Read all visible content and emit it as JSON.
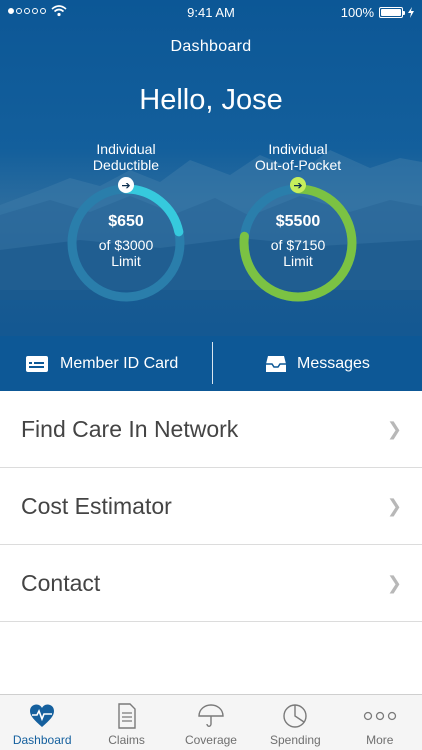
{
  "status_bar": {
    "time": "9:41 AM",
    "battery_label": "100%"
  },
  "nav": {
    "title": "Dashboard"
  },
  "greeting": "Hello, Jose",
  "gauges": [
    {
      "label_line1": "Individual",
      "label_line2": "Deductible",
      "amount": "$650",
      "limit_line1": "of $3000",
      "limit_line2": "Limit",
      "spent": 650,
      "limit": 3000,
      "color": "#36c9dd"
    },
    {
      "label_line1": "Individual",
      "label_line2": "Out-of-Pocket",
      "amount": "$5500",
      "limit_line1": "of $7150",
      "limit_line2": "Limit",
      "spent": 5500,
      "limit": 7150,
      "color": "#7bc243"
    }
  ],
  "actions": {
    "member_id": "Member ID Card",
    "messages": "Messages"
  },
  "list": [
    {
      "label": "Find Care In Network"
    },
    {
      "label": "Cost Estimator"
    },
    {
      "label": "Contact"
    }
  ],
  "tabs": [
    {
      "label": "Dashboard",
      "icon": "heart-pulse-icon",
      "active": true
    },
    {
      "label": "Claims",
      "icon": "document-icon",
      "active": false
    },
    {
      "label": "Coverage",
      "icon": "umbrella-icon",
      "active": false
    },
    {
      "label": "Spending",
      "icon": "pie-chart-icon",
      "active": false
    },
    {
      "label": "More",
      "icon": "more-dots-icon",
      "active": false
    }
  ],
  "colors": {
    "primary": "#0d5896",
    "accent_teal": "#36c9dd",
    "accent_green": "#7bc243"
  }
}
